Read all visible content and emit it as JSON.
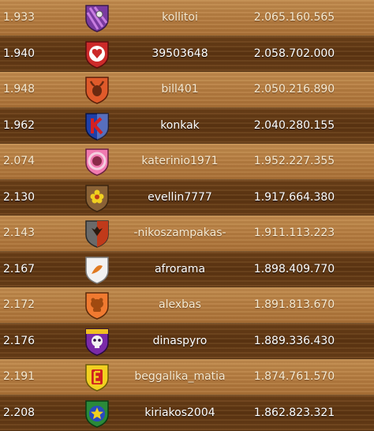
{
  "rows": [
    {
      "rank": "1.933",
      "name": "kollitoi",
      "score": "2.065.160.565",
      "emblem": "purple-stripe-pin-emblem-icon",
      "colors": {
        "bg": "#7a3aa0",
        "accent": "#c77de0"
      }
    },
    {
      "rank": "1.940",
      "name": "39503648",
      "score": "2.058.702.000",
      "emblem": "red-heart-emblem-icon",
      "colors": {
        "bg": "#cc2a2a",
        "accent": "#ffffff"
      }
    },
    {
      "rank": "1.948",
      "name": "bill401",
      "score": "2.050.216.890",
      "emblem": "bull-horns-emblem-icon",
      "colors": {
        "bg": "#e05a2a",
        "accent": "#6b2a10"
      }
    },
    {
      "rank": "1.962",
      "name": "konkak",
      "score": "2.040.280.155",
      "emblem": "blue-red-k-letter-emblem-icon",
      "colors": {
        "bg": "#1f3fa8",
        "accent": "#d62020"
      }
    },
    {
      "rank": "2.074",
      "name": "katerinio1971",
      "score": "1.952.227.355",
      "emblem": "pink-ring-emblem-icon",
      "colors": {
        "bg": "#f07ab0",
        "accent": "#8a2a4a"
      }
    },
    {
      "rank": "2.130",
      "name": "evellin7777",
      "score": "1.917.664.380",
      "emblem": "brown-flower-emblem-icon",
      "colors": {
        "bg": "#8a6236",
        "accent": "#f0d020"
      }
    },
    {
      "rank": "2.143",
      "name": "-nikoszampakas-",
      "score": "1.911.113.223",
      "emblem": "gray-red-eagle-emblem-icon",
      "colors": {
        "bg": "#6a6a6a",
        "accent": "#c03a1a"
      }
    },
    {
      "rank": "2.167",
      "name": "afrorama",
      "score": "1.898.409.770",
      "emblem": "white-orange-emblem-icon",
      "colors": {
        "bg": "#f2f2f2",
        "accent": "#e07a20"
      }
    },
    {
      "rank": "2.172",
      "name": "alexbas",
      "score": "1.891.813.670",
      "emblem": "orange-animal-emblem-icon",
      "colors": {
        "bg": "#f07a30",
        "accent": "#a04a10"
      }
    },
    {
      "rank": "2.176",
      "name": "dinaspyro",
      "score": "1.889.336.430",
      "emblem": "purple-skull-emblem-icon",
      "colors": {
        "bg": "#7a2aa8",
        "accent": "#f0c020"
      }
    },
    {
      "rank": "2.191",
      "name": "beggalika_matia",
      "score": "1.874.761.570",
      "emblem": "yellow-e-letter-emblem-icon",
      "colors": {
        "bg": "#f2d020",
        "accent": "#d02020"
      }
    },
    {
      "rank": "2.208",
      "name": "kiriakos2004",
      "score": "1.862.823.321",
      "emblem": "green-star-emblem-icon",
      "colors": {
        "bg": "#2a8a3a",
        "accent": "#2a4ac0"
      }
    }
  ]
}
